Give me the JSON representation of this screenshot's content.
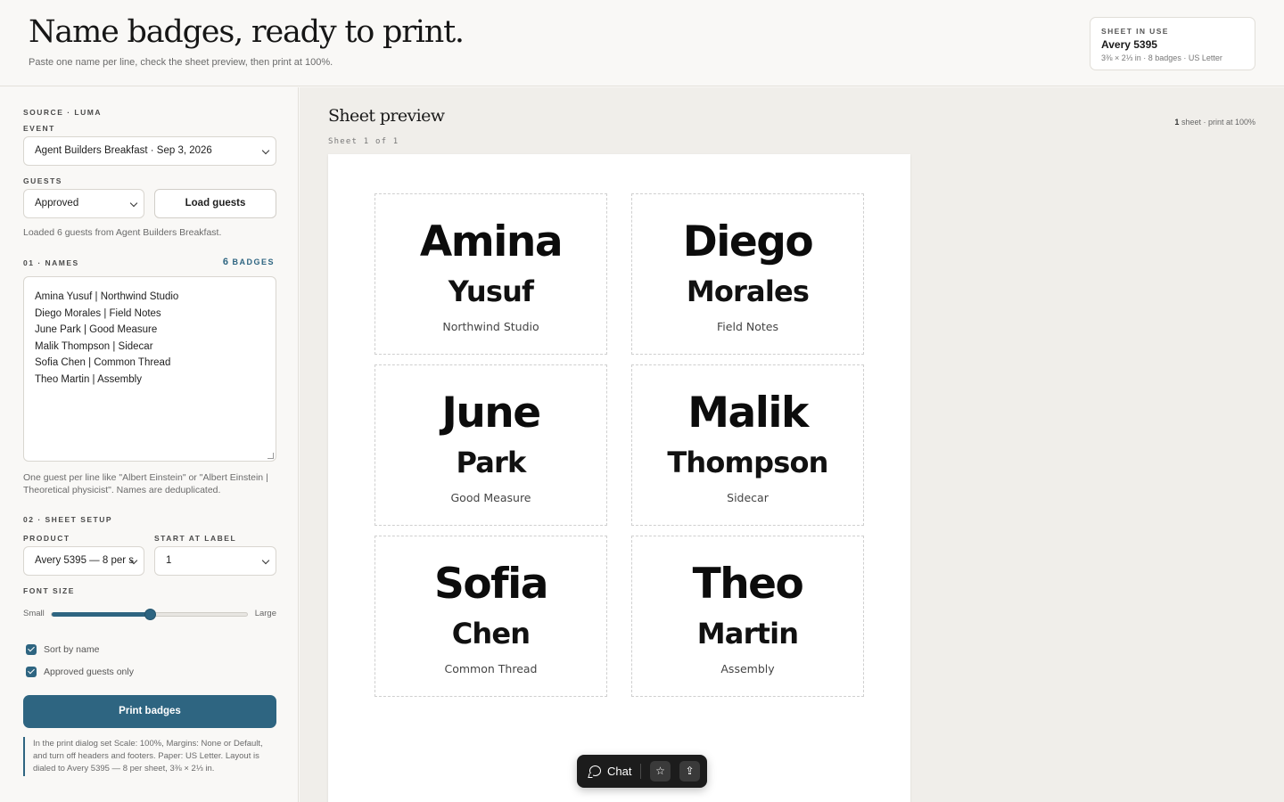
{
  "header": {
    "title": "Name badges, ready to print.",
    "subtitle": "Paste one name per line, check the sheet preview, then print at 100%.",
    "sheet_card": {
      "kicker": "SHEET IN USE",
      "name": "Avery 5395",
      "meta": "3⅜ × 2⅓ in · 8 badges · US Letter"
    }
  },
  "sidebar": {
    "source_label": "SOURCE · LUMA",
    "event_label": "EVENT",
    "event_value": "Agent Builders Breakfast · Sep 3, 2026",
    "guests_label": "GUESTS",
    "guests_value": "Approved",
    "load_button": "Load guests",
    "loaded_status": "Loaded 6 guests from Agent Builders Breakfast.",
    "names_label": "01 · NAMES",
    "badge_count_number": "6",
    "badge_count_label": "BADGES",
    "names_lines": [
      "Amina Yusuf | Northwind Studio",
      "Diego Morales | Field Notes",
      "June Park | Good Measure",
      "Malik Thompson | Sidecar",
      "Sofia Chen | Common Thread",
      "Theo Martin | Assembly"
    ],
    "names_hint": "One guest per line like \"Albert Einstein\" or \"Albert Einstein | Theoretical physicist\". Names are deduplicated.",
    "sheet_setup_label": "02 · SHEET SETUP",
    "product_label": "PRODUCT",
    "product_value": "Avery 5395 — 8 per s",
    "start_label": "START AT LABEL",
    "start_value": "1",
    "font_size_label": "FONT SIZE",
    "font_small": "Small",
    "font_large": "Large",
    "font_size_level": 0.5,
    "sort_by_name": "Sort by name",
    "approved_only": "Approved guests only",
    "print_button": "Print badges",
    "print_note": "In the print dialog set Scale: 100%, Margins: None or Default, and turn off headers and footers. Paper: US Letter. Layout is dialed to Avery 5395 — 8 per sheet, 3⅜ × 2⅓ in."
  },
  "preview": {
    "title": "Sheet preview",
    "meta_count": "1",
    "meta_rest": " sheet · print at 100%",
    "sheet_counter": "Sheet 1 of 1",
    "badges": [
      {
        "first": "Amina",
        "last": "Yusuf",
        "org": "Northwind Studio"
      },
      {
        "first": "Diego",
        "last": "Morales",
        "org": "Field Notes"
      },
      {
        "first": "June",
        "last": "Park",
        "org": "Good Measure"
      },
      {
        "first": "Malik",
        "last": "Thompson",
        "org": "Sidecar"
      },
      {
        "first": "Sofia",
        "last": "Chen",
        "org": "Common Thread"
      },
      {
        "first": "Theo",
        "last": "Martin",
        "org": "Assembly"
      }
    ]
  },
  "chatbar": {
    "chat_label": "Chat",
    "star_icon": "☆",
    "share_icon": "⇪"
  },
  "colors": {
    "accent": "#2e6581",
    "background": "#f9f8f6",
    "preview_bg": "#f0eeea"
  }
}
